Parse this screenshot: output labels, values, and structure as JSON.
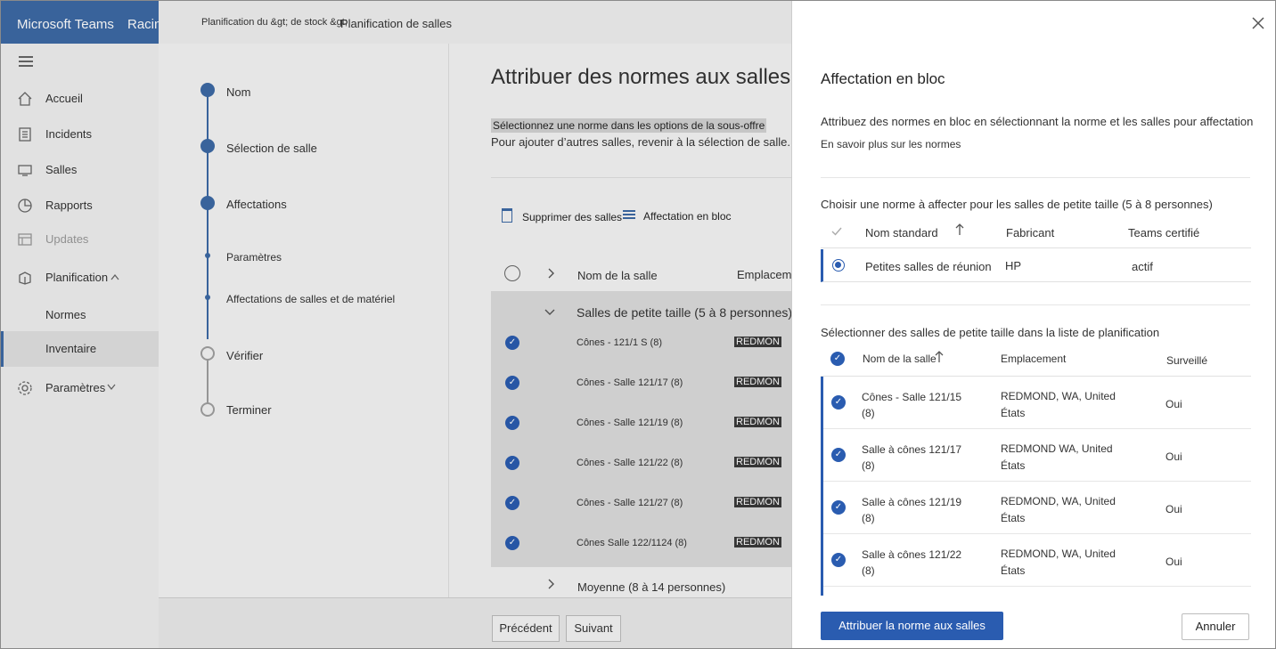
{
  "app": {
    "brand": "Microsoft Teams",
    "home": "Racine"
  },
  "breadcrumb": {
    "part1": "Planification du &gt; de stock &gt;",
    "part2": "Planification de salles"
  },
  "nav": [
    {
      "label": "Accueil",
      "icon": "home-icon"
    },
    {
      "label": "Incidents",
      "icon": "incidents-icon"
    },
    {
      "label": "Salles",
      "icon": "rooms-icon"
    },
    {
      "label": "Rapports",
      "icon": "reports-icon"
    },
    {
      "label": "Updates",
      "icon": "updates-icon"
    },
    {
      "label": "Planification",
      "icon": "planning-icon"
    },
    {
      "label": "Normes"
    },
    {
      "label": "Inventaire"
    },
    {
      "label": "Paramètres",
      "icon": "gear-icon"
    }
  ],
  "steps": [
    "Nom",
    "Sélection de salle",
    "Affectations",
    "Paramètres",
    "Affectations de salles et de matériel",
    "Vérifier",
    "Terminer"
  ],
  "main": {
    "title": "Attribuer des normes aux salles",
    "desc1": "Sélectionnez une norme dans les options de la sous-offre",
    "desc2": "Pour ajouter d’autres salles, revenir à la sélection de salle.",
    "delete_rooms": "Supprimer des salles",
    "bulk_assign": "Affectation en bloc",
    "col_room_name": "Nom de la salle",
    "col_location": "Emplacement",
    "group_small": "Salles de petite taille (5 à 8 personnes)",
    "group_medium": "Moyenne (8 à 14 personnes)",
    "rooms": [
      {
        "name": "Cônes - 121/1 S (8)",
        "location": "REDMON"
      },
      {
        "name": "Cônes - Salle 121/17 (8)",
        "location": "REDMON"
      },
      {
        "name": "Cônes - Salle 121/19 (8)",
        "location": "REDMON"
      },
      {
        "name": "Cônes - Salle 121/22 (8)",
        "location": "REDMON"
      },
      {
        "name": "Cônes - Salle 121/27 (8)",
        "location": "REDMON"
      },
      {
        "name": "Cônes Salle 122/1124 (8)",
        "location": "REDMON"
      }
    ]
  },
  "footer": {
    "previous": "Précédent",
    "next": "Suivant"
  },
  "panel": {
    "title": "Affectation en bloc",
    "description": "Attribuez des normes en bloc en sélectionnant la norme et les salles pour affectation",
    "learn_more": "En savoir plus sur les normes",
    "choose_standard": "Choisir une norme à affecter pour les salles de petite taille (5 à 8 personnes)",
    "std_headers": {
      "name": "Nom standard",
      "manufacturer": "Fabricant",
      "certified": "Teams certifié"
    },
    "standard": {
      "name": "Petites salles de réunion",
      "manufacturer": "HP",
      "certified": "actif"
    },
    "select_rooms": "Sélectionner des salles de petite taille dans la liste de planification",
    "room_headers": {
      "name": "Nom de la salle",
      "location": "Emplacement",
      "monitored": "Surveillé"
    },
    "rooms": [
      {
        "name": "Cônes - Salle 121/15 (8)",
        "location": "REDMOND, WA, United États",
        "monitored": "Oui"
      },
      {
        "name": "Salle à cônes 121/17 (8)",
        "location": "REDMOND WA, United États",
        "monitored": "Oui"
      },
      {
        "name": "Salle à cônes 121/19 (8)",
        "location": "REDMOND, WA, United États",
        "monitored": "Oui"
      },
      {
        "name": "Salle à cônes 121/22 (8)",
        "location": "REDMOND, WA, United États",
        "monitored": "Oui"
      }
    ],
    "assign_button": "Attribuer la norme aux salles",
    "cancel_button": "Annuler"
  },
  "colors": {
    "brand": "#3d6aa5",
    "accent": "#2a5cb0"
  }
}
